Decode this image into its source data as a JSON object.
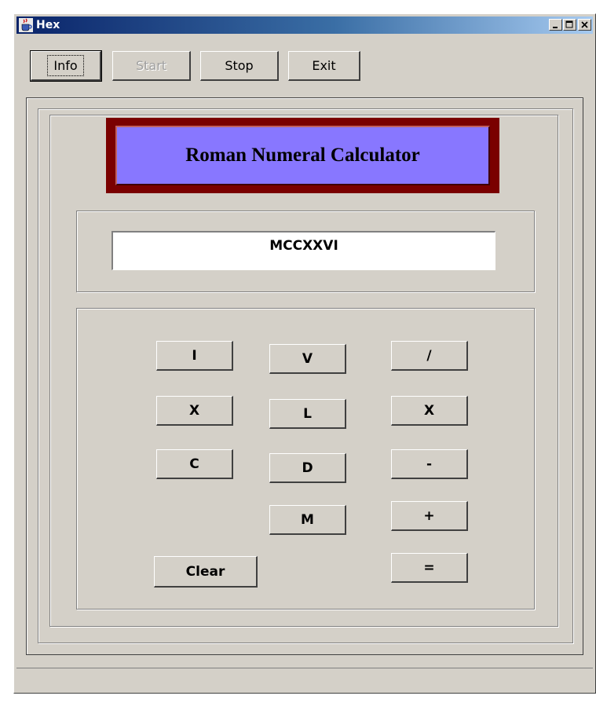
{
  "window": {
    "title": "Hex"
  },
  "toolbar": {
    "info_label": "Info",
    "start_label": "Start",
    "stop_label": "Stop",
    "exit_label": "Exit"
  },
  "banner": {
    "title": "Roman Numeral Calculator"
  },
  "display": {
    "value": "MCCXXVI"
  },
  "keys": {
    "I": "I",
    "V": "V",
    "X": "X",
    "L": "L",
    "C": "C",
    "D": "D",
    "M": "M",
    "divide": "/",
    "multiply": "X",
    "minus": "-",
    "plus": "+",
    "equals": "=",
    "clear": "Clear"
  },
  "colors": {
    "title_bar_start": "#0a246a",
    "title_bar_end": "#a6caf0",
    "banner_frame": "#7a0000",
    "banner_fill": "#8877ff",
    "window_bg": "#d4d0c8"
  },
  "icons": {
    "app": "java-cup-icon",
    "minimize": "minimize-icon",
    "maximize": "maximize-icon",
    "close": "close-icon"
  }
}
